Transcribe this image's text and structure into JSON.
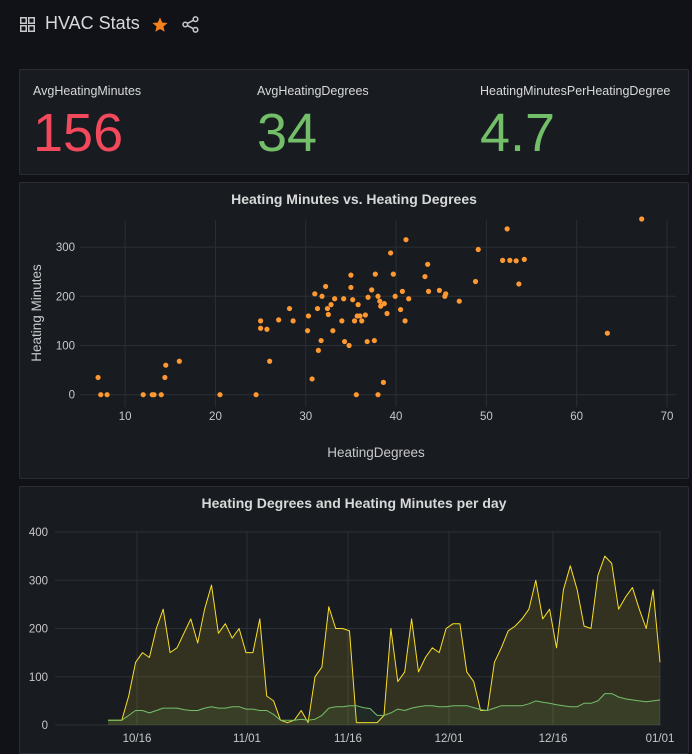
{
  "dashboard": {
    "title": "HVAC Stats",
    "accent_color": "#f6811b",
    "icons": [
      "grid-icon",
      "star-icon",
      "share-icon"
    ]
  },
  "stats": [
    {
      "label": "AvgHeatingMinutes",
      "value": "156",
      "color": "#f2495c"
    },
    {
      "label": "AvgHeatingDegrees",
      "value": "34",
      "color": "#73bf69"
    },
    {
      "label": "HeatingMinutesPerHeatingDegree",
      "value": "4.7",
      "color": "#73bf69"
    }
  ],
  "scatter_panel": {
    "title": "Heating Minutes vs. Heating Degrees"
  },
  "timeseries_panel": {
    "title": "Heating Degrees and Heating Minutes per day"
  },
  "chart_data": [
    {
      "type": "scatter",
      "title": "Heating Minutes vs. Heating Degrees",
      "xlabel": "HeatingDegrees",
      "ylabel": "Heating Minutes",
      "xlim": [
        5,
        71
      ],
      "ylim": [
        -25,
        355
      ],
      "xticks": [
        10,
        20,
        30,
        40,
        50,
        60,
        70
      ],
      "yticks": [
        0,
        100,
        200,
        300
      ],
      "grid": true,
      "point_color": "#ff9830",
      "x": [
        7,
        7.3,
        8,
        12,
        13,
        13.2,
        14,
        14.5,
        14.4,
        16,
        20.5,
        24.5,
        25,
        25,
        25.7,
        26,
        27,
        28.2,
        28.6,
        30.2,
        30.3,
        30.7,
        31,
        31.3,
        31.4,
        31.7,
        31.8,
        32.2,
        32.4,
        32.5,
        32.8,
        33,
        33.2,
        34,
        34.2,
        34.3,
        34.8,
        35,
        35,
        35.2,
        35.4,
        35.6,
        35.7,
        35.8,
        36,
        36.2,
        36.6,
        36.8,
        36.9,
        37.3,
        37.6,
        37.7,
        38,
        38,
        38.2,
        38.3,
        38.6,
        38.7,
        39,
        39.4,
        39.7,
        39.9,
        40.5,
        40.7,
        41,
        41.1,
        41.4,
        43.2,
        43.5,
        43.6,
        44.8,
        45.4,
        45.5,
        47,
        48.8,
        49.1,
        51.8,
        52.3,
        52.6,
        53.3,
        53.6,
        54.2,
        63.4,
        67.2
      ],
      "y": [
        35,
        0,
        0,
        0,
        0,
        0,
        0,
        60,
        35,
        68,
        0,
        0,
        150,
        135,
        133,
        68,
        152,
        175,
        150,
        130,
        160,
        32,
        205,
        175,
        90,
        110,
        200,
        220,
        175,
        163,
        183,
        130,
        195,
        150,
        195,
        108,
        100,
        243,
        218,
        193,
        150,
        0,
        160,
        183,
        160,
        150,
        162,
        108,
        198,
        213,
        110,
        245,
        0,
        200,
        190,
        180,
        25,
        185,
        165,
        288,
        245,
        200,
        173,
        210,
        150,
        315,
        195,
        240,
        265,
        210,
        212,
        200,
        205,
        190,
        230,
        295,
        273,
        337,
        273,
        272,
        225,
        275,
        125,
        357,
        275
      ]
    },
    {
      "type": "area",
      "title": "Heating Degrees and Heating Minutes per day",
      "ylim": [
        0,
        400
      ],
      "yticks": [
        0,
        100,
        200,
        300,
        400
      ],
      "x_start": "10/08",
      "x_end": "01/01",
      "xticks": [
        "10/16",
        "11/01",
        "11/16",
        "12/01",
        "12/16",
        "01/01"
      ],
      "grid": true,
      "series": [
        {
          "color": "#fade2a",
          "values": [
            10,
            10,
            10,
            60,
            130,
            150,
            140,
            200,
            240,
            150,
            160,
            190,
            220,
            170,
            240,
            290,
            190,
            210,
            180,
            200,
            150,
            150,
            220,
            60,
            50,
            10,
            5,
            10,
            30,
            5,
            100,
            120,
            245,
            200,
            200,
            195,
            5,
            5,
            5,
            5,
            20,
            200,
            90,
            110,
            220,
            110,
            140,
            160,
            150,
            200,
            210,
            210,
            110,
            90,
            30,
            30,
            130,
            160,
            195,
            205,
            220,
            240,
            300,
            220,
            240,
            160,
            280,
            330,
            280,
            205,
            200,
            310,
            350,
            335,
            240,
            265,
            285,
            240,
            200,
            280,
            130
          ]
        },
        {
          "color": "#73bf69",
          "values": [
            10,
            10,
            10,
            20,
            30,
            30,
            25,
            30,
            35,
            35,
            35,
            32,
            30,
            30,
            35,
            38,
            35,
            35,
            38,
            38,
            33,
            33,
            30,
            30,
            22,
            10,
            10,
            10,
            12,
            10,
            12,
            20,
            35,
            38,
            38,
            40,
            40,
            36,
            34,
            20,
            20,
            25,
            33,
            30,
            35,
            38,
            40,
            40,
            38,
            38,
            40,
            40,
            40,
            36,
            32,
            30,
            35,
            40,
            40,
            40,
            40,
            44,
            50,
            47,
            45,
            42,
            40,
            38,
            38,
            45,
            45,
            50,
            65,
            65,
            58,
            54,
            52,
            50,
            48,
            50,
            52
          ]
        }
      ]
    }
  ]
}
